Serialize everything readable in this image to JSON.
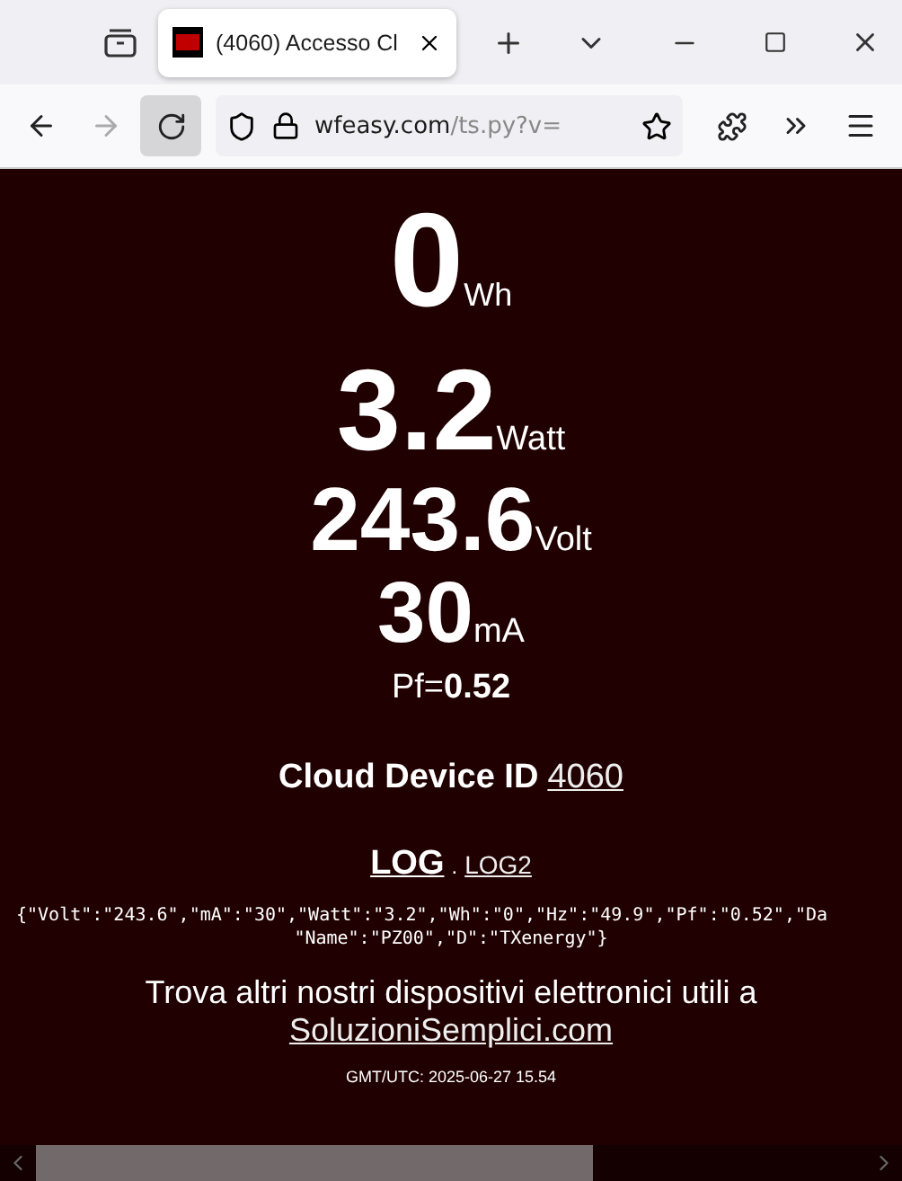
{
  "browser": {
    "tab": {
      "title": "(4060) Accesso Cl",
      "selected": true
    },
    "url": {
      "host": "wfeasy.com",
      "path": "/ts.py?v="
    }
  },
  "readings": [
    {
      "value": "0",
      "unit": "Wh"
    },
    {
      "value": "3.2",
      "unit": "Watt"
    },
    {
      "value": "243.6",
      "unit": "Volt"
    },
    {
      "value": "30",
      "unit": "mA"
    }
  ],
  "power_factor": {
    "label": "Pf=",
    "value": "0.52"
  },
  "cloud_device": {
    "label": "Cloud Device ID",
    "id": "4060"
  },
  "links": {
    "log": "LOG",
    "separator": ".",
    "log2": "LOG2"
  },
  "json_dump": [
    "{\"Volt\":\"243.6\",\"mA\":\"30\",\"Watt\":\"3.2\",\"Wh\":\"0\",\"Hz\":\"49.9\",\"Pf\":\"0.52\",\"Da",
    "\"Name\":\"PZ00\",\"D\":\"TXenergy\"}"
  ],
  "promo": {
    "text": "Trova altri nostri dispositivi elettronici utili a",
    "link": "SoluzioniSemplici.com"
  },
  "timestamp": "GMT/UTC: 2025-06-27 15.54"
}
